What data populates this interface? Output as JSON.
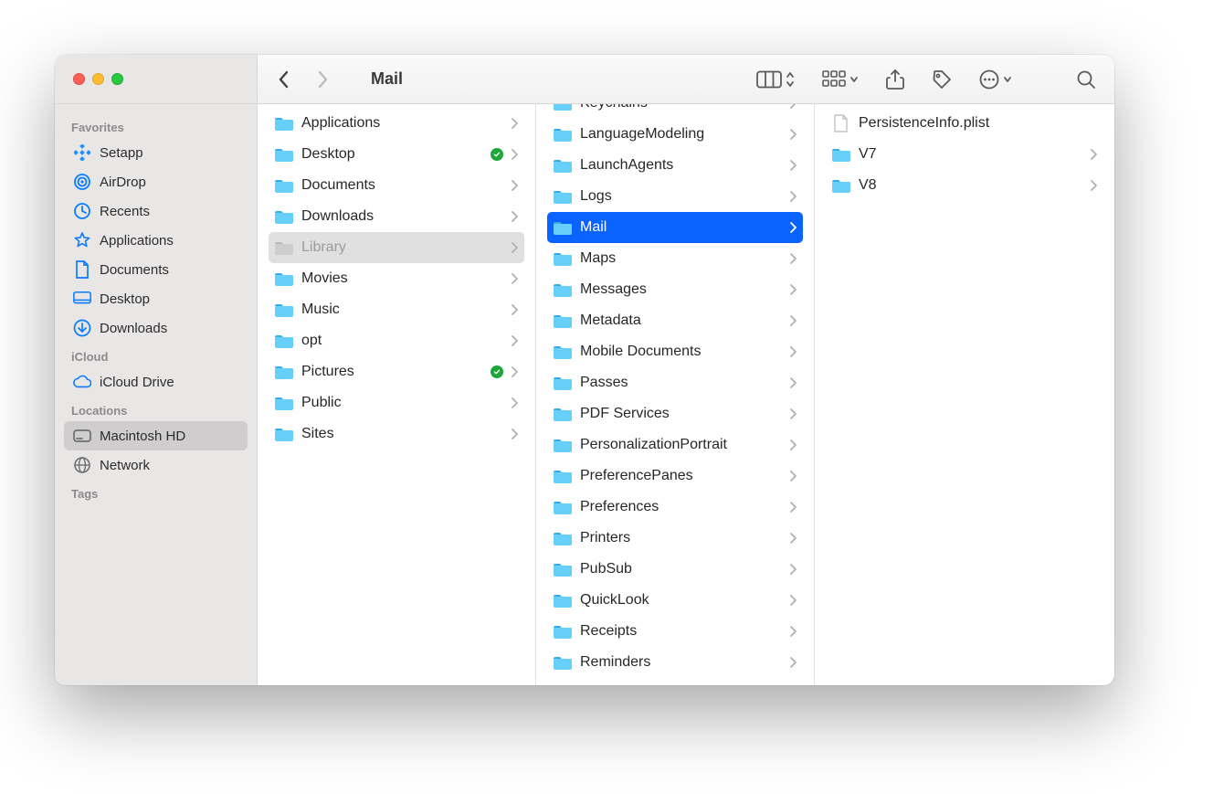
{
  "window_title": "Mail",
  "sidebar": {
    "groups": [
      {
        "label": "Favorites",
        "items": [
          {
            "icon": "setapp",
            "label": "Setapp"
          },
          {
            "icon": "airdrop",
            "label": "AirDrop"
          },
          {
            "icon": "recents",
            "label": "Recents"
          },
          {
            "icon": "apps",
            "label": "Applications"
          },
          {
            "icon": "doc",
            "label": "Documents"
          },
          {
            "icon": "desktop",
            "label": "Desktop"
          },
          {
            "icon": "downloads",
            "label": "Downloads"
          }
        ]
      },
      {
        "label": "iCloud",
        "items": [
          {
            "icon": "cloud",
            "label": "iCloud Drive"
          }
        ]
      },
      {
        "label": "Locations",
        "items": [
          {
            "icon": "disk",
            "label": "Macintosh HD",
            "selected": true,
            "grey": true
          },
          {
            "icon": "globe",
            "label": "Network",
            "grey": true
          }
        ]
      },
      {
        "label": "Tags",
        "items": []
      }
    ]
  },
  "columns": [
    {
      "start_at": 0,
      "items": [
        {
          "type": "folder",
          "label": "Applications",
          "chev": true
        },
        {
          "type": "folder",
          "label": "Desktop",
          "chev": true,
          "sync": true
        },
        {
          "type": "folder",
          "label": "Documents",
          "chev": true
        },
        {
          "type": "folder",
          "label": "Downloads",
          "chev": true
        },
        {
          "type": "folder",
          "label": "Library",
          "chev": true,
          "state": "dim"
        },
        {
          "type": "folder",
          "label": "Movies",
          "chev": true
        },
        {
          "type": "folder",
          "label": "Music",
          "chev": true
        },
        {
          "type": "folder",
          "label": "opt",
          "chev": true
        },
        {
          "type": "folder",
          "label": "Pictures",
          "chev": true,
          "sync": true
        },
        {
          "type": "folder",
          "label": "Public",
          "chev": true
        },
        {
          "type": "folder",
          "label": "Sites",
          "chev": true
        }
      ]
    },
    {
      "start_at": -1,
      "items": [
        {
          "type": "folder",
          "label": "Keychains",
          "chev": true,
          "partial": true
        },
        {
          "type": "folder",
          "label": "LanguageModeling",
          "chev": true
        },
        {
          "type": "folder",
          "label": "LaunchAgents",
          "chev": true
        },
        {
          "type": "folder",
          "label": "Logs",
          "chev": true
        },
        {
          "type": "folder",
          "label": "Mail",
          "chev": true,
          "state": "blue"
        },
        {
          "type": "folder",
          "label": "Maps",
          "chev": true
        },
        {
          "type": "folder",
          "label": "Messages",
          "chev": true
        },
        {
          "type": "folder",
          "label": "Metadata",
          "chev": true
        },
        {
          "type": "folder",
          "label": "Mobile Documents",
          "chev": true
        },
        {
          "type": "folder",
          "label": "Passes",
          "chev": true
        },
        {
          "type": "folder",
          "label": "PDF Services",
          "chev": true
        },
        {
          "type": "folder",
          "label": "PersonalizationPortrait",
          "chev": true
        },
        {
          "type": "folder",
          "label": "PreferencePanes",
          "chev": true
        },
        {
          "type": "folder",
          "label": "Preferences",
          "chev": true
        },
        {
          "type": "folder",
          "label": "Printers",
          "chev": true
        },
        {
          "type": "folder",
          "label": "PubSub",
          "chev": true
        },
        {
          "type": "folder",
          "label": "QuickLook",
          "chev": true
        },
        {
          "type": "folder",
          "label": "Receipts",
          "chev": true
        },
        {
          "type": "folder",
          "label": "Reminders",
          "chev": true
        }
      ]
    },
    {
      "start_at": 0,
      "items": [
        {
          "type": "file",
          "label": "PersistenceInfo.plist"
        },
        {
          "type": "folder",
          "label": "V7",
          "chev": true
        },
        {
          "type": "folder",
          "label": "V8",
          "chev": true
        }
      ]
    }
  ]
}
